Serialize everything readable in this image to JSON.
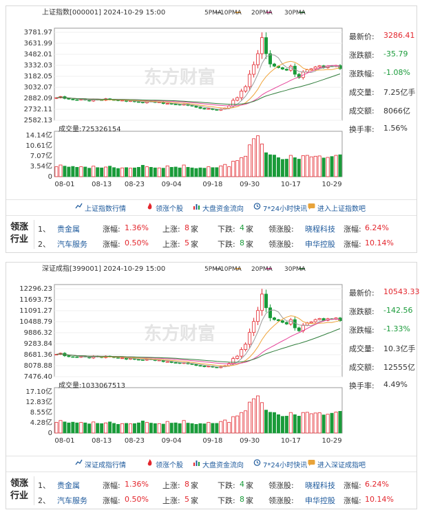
{
  "panels": [
    {
      "title": "上证指数[000001] 2024-10-29 15:00",
      "ma_legend": [
        "5PMA",
        "10PMA",
        "20PMA",
        "30PMA"
      ],
      "price_axis": [
        "3781.97",
        "3631.99",
        "3482.01",
        "3332.03",
        "3182.05",
        "3032.07",
        "2882.09",
        "2732.11",
        "2582.13"
      ],
      "volume_label": "成交量:725326154",
      "volume_axis": [
        "14.14亿",
        "10.61亿",
        "7.07亿",
        "3.54亿",
        "0"
      ],
      "x_labels": [
        "08-01",
        "08-13",
        "08-23",
        "09-04",
        "09-18",
        "09-30",
        "10-17",
        "10-29"
      ],
      "stats": [
        {
          "label": "最新价:",
          "value": "3286.41",
          "color": "red"
        },
        {
          "label": "涨跌额:",
          "value": "-35.79",
          "color": "green"
        },
        {
          "label": "涨跌幅:",
          "value": "-1.08%",
          "color": "green"
        },
        {
          "label": "成交量:",
          "value": "7.25亿手",
          "color": "muted"
        },
        {
          "label": "成交额:",
          "value": "8066亿",
          "color": "muted"
        },
        {
          "label": "换手率:",
          "value": "1.56%",
          "color": "muted"
        }
      ],
      "links": [
        "上证指数行情",
        "领涨个股",
        "大盘资金流向",
        "7*24小时快讯",
        "进入上证指数吧"
      ],
      "leaders_title": "领涨行业",
      "leaders": [
        {
          "rank": "1、",
          "industry": "贵金属",
          "chg_label": "涨幅:",
          "chg": "1.36%",
          "up_label": "上涨:",
          "up": "8",
          "up_unit": "家",
          "down_label": "下跌:",
          "down": "4",
          "down_unit": "家",
          "lead_label": "领涨股:",
          "stock": "晓程科技",
          "stock_chg_label": "涨幅:",
          "stock_chg": "6.24%"
        },
        {
          "rank": "2、",
          "industry": "汽车服务",
          "chg_label": "涨幅:",
          "chg": "0.50%",
          "up_label": "上涨:",
          "up": "5",
          "up_unit": "家",
          "down_label": "下跌:",
          "down": "8",
          "down_unit": "家",
          "lead_label": "领涨股:",
          "stock": "申华控股",
          "stock_chg_label": "涨幅:",
          "stock_chg": "10.14%"
        }
      ],
      "watermark": "东方财富"
    },
    {
      "title": "深证成指[399001] 2024-10-29 15:00",
      "ma_legend": [
        "5PMA",
        "10PMA",
        "20PMA",
        "30PMA"
      ],
      "price_axis": [
        "12296.23",
        "11693.75",
        "11091.27",
        "10488.79",
        "9886.32",
        "9283.84",
        "8681.36",
        "8078.88",
        "7476.40"
      ],
      "volume_label": "成交量:1033067513",
      "volume_axis": [
        "17.10亿",
        "12.83亿",
        "8.55亿",
        "4.28亿",
        "0"
      ],
      "x_labels": [
        "08-01",
        "08-13",
        "08-23",
        "09-04",
        "09-18",
        "09-30",
        "10-17",
        "10-29"
      ],
      "stats": [
        {
          "label": "最新价:",
          "value": "10543.33",
          "color": "red"
        },
        {
          "label": "涨跌额:",
          "value": "-142.56",
          "color": "green"
        },
        {
          "label": "涨跌幅:",
          "value": "-1.33%",
          "color": "green"
        },
        {
          "label": "成交量:",
          "value": "10.3亿手",
          "color": "muted"
        },
        {
          "label": "成交额:",
          "value": "12555亿",
          "color": "muted"
        },
        {
          "label": "换手率:",
          "value": "4.49%",
          "color": "muted"
        }
      ],
      "links": [
        "深证成指行情",
        "领涨个股",
        "大盘资金流向",
        "7*24小时快讯",
        "进入深证成指吧"
      ],
      "leaders_title": "领涨行业",
      "leaders": [
        {
          "rank": "1、",
          "industry": "贵金属",
          "chg_label": "涨幅:",
          "chg": "1.36%",
          "up_label": "上涨:",
          "up": "8",
          "up_unit": "家",
          "down_label": "下跌:",
          "down": "4",
          "down_unit": "家",
          "lead_label": "领涨股:",
          "stock": "晓程科技",
          "stock_chg_label": "涨幅:",
          "stock_chg": "6.24%"
        },
        {
          "rank": "2、",
          "industry": "汽车服务",
          "chg_label": "涨幅:",
          "chg": "0.50%",
          "up_label": "上涨:",
          "up": "5",
          "up_unit": "家",
          "down_label": "下跌:",
          "down": "8",
          "down_unit": "家",
          "lead_label": "领涨股:",
          "stock": "申华控股",
          "stock_chg_label": "涨幅:",
          "stock_chg": "10.14%"
        }
      ],
      "watermark": "东方财富"
    }
  ],
  "colors": {
    "up": "#e3262d",
    "down": "#1a9b3a",
    "ma5": "#9a9a9a",
    "ma10": "#f0a43a",
    "ma20": "#e6459a",
    "ma30": "#2f7d3b",
    "link": "#1e5a9c"
  },
  "icons": [
    "chart-line-icon",
    "fire-icon",
    "bar-chart-icon",
    "clock-icon",
    "forum-icon"
  ],
  "chart_data": [
    {
      "type": "candlestick",
      "title": "上证指数[000001] 2024-10-29 15:00",
      "ylim": [
        2582.13,
        3781.97
      ],
      "x_ticks": [
        "08-01",
        "08-13",
        "08-23",
        "09-04",
        "09-18",
        "09-30",
        "10-17",
        "10-29"
      ],
      "close": [
        2890,
        2905,
        2880,
        2870,
        2862,
        2860,
        2868,
        2858,
        2845,
        2866,
        2860,
        2855,
        2875,
        2862,
        2858,
        2850,
        2855,
        2840,
        2848,
        2835,
        2830,
        2820,
        2842,
        2838,
        2825,
        2830,
        2810,
        2812,
        2802,
        2800,
        2790,
        2802,
        2785,
        2776,
        2760,
        2745,
        2735,
        2742,
        2728,
        2720,
        2735,
        2748,
        2780,
        2855,
        2890,
        2980,
        3040,
        3210,
        3340,
        3490,
        3710,
        3490,
        3350,
        3320,
        3300,
        3280,
        3265,
        3320,
        3210,
        3165,
        3240,
        3270,
        3285,
        3310,
        3325,
        3298,
        3322,
        3315,
        3330,
        3286
      ],
      "volume_ylim": [
        0,
        14.14
      ],
      "volume_unit": "亿",
      "volume": [
        3.4,
        4.0,
        3.6,
        3.3,
        3.5,
        3.2,
        3.4,
        3.3,
        2.9,
        3.6,
        3.1,
        3.0,
        3.3,
        3.6,
        3.1,
        2.8,
        3.0,
        3.1,
        2.9,
        3.0,
        3.2,
        3.9,
        3.4,
        3.2,
        3.0,
        3.0,
        2.9,
        3.7,
        3.2,
        3.3,
        3.0,
        4.0,
        3.2,
        3.0,
        2.8,
        3.0,
        2.9,
        3.4,
        3.1,
        3.1,
        3.7,
        4.2,
        3.4,
        5.3,
        5.5,
        6.5,
        7.0,
        10.9,
        13.0,
        14.0,
        11.2,
        8.2,
        7.5,
        7.4,
        6.5,
        5.9,
        6.0,
        7.3,
        6.5,
        6.0,
        7.2,
        7.3,
        6.8,
        7.0,
        7.1,
        6.4,
        6.6,
        6.9,
        7.3,
        7.5
      ]
    },
    {
      "type": "candlestick",
      "title": "深证成指[399001] 2024-10-29 15:00",
      "ylim": [
        7476.4,
        12296.23
      ],
      "x_ticks": [
        "08-01",
        "08-13",
        "08-23",
        "09-04",
        "09-18",
        "09-30",
        "10-17",
        "10-29"
      ],
      "close": [
        8700,
        8760,
        8620,
        8570,
        8560,
        8540,
        8590,
        8560,
        8500,
        8600,
        8560,
        8520,
        8600,
        8560,
        8520,
        8500,
        8500,
        8430,
        8470,
        8420,
        8400,
        8380,
        8440,
        8420,
        8360,
        8380,
        8300,
        8300,
        8250,
        8240,
        8200,
        8240,
        8180,
        8150,
        8090,
        8060,
        8020,
        8050,
        8000,
        7970,
        8030,
        8080,
        8200,
        8470,
        8600,
        8960,
        9250,
        9900,
        10500,
        11100,
        12000,
        11250,
        10700,
        10600,
        10540,
        10450,
        10360,
        10600,
        10150,
        9990,
        10300,
        10420,
        10480,
        10600,
        10660,
        10560,
        10650,
        10620,
        10690,
        10543
      ],
      "volume_ylim": [
        0,
        17.1
      ],
      "volume_unit": "亿",
      "volume": [
        4.4,
        5.2,
        4.6,
        4.2,
        4.5,
        4.2,
        4.4,
        4.2,
        3.8,
        4.6,
        4.0,
        3.9,
        4.2,
        4.6,
        4.0,
        3.6,
        3.9,
        4.0,
        3.8,
        3.9,
        4.2,
        5.0,
        4.4,
        4.1,
        3.9,
        3.9,
        3.7,
        4.8,
        4.1,
        4.2,
        3.9,
        5.2,
        4.1,
        3.9,
        3.6,
        3.9,
        3.8,
        4.4,
        4.0,
        4.0,
        4.8,
        5.4,
        4.4,
        6.8,
        7.1,
        8.5,
        9.2,
        12.8,
        14.2,
        15.4,
        12.6,
        9.5,
        8.6,
        8.5,
        7.6,
        6.9,
        7.0,
        8.5,
        7.6,
        7.0,
        8.5,
        8.6,
        8.0,
        8.3,
        8.4,
        7.5,
        7.8,
        8.2,
        8.7,
        9.0
      ]
    }
  ]
}
